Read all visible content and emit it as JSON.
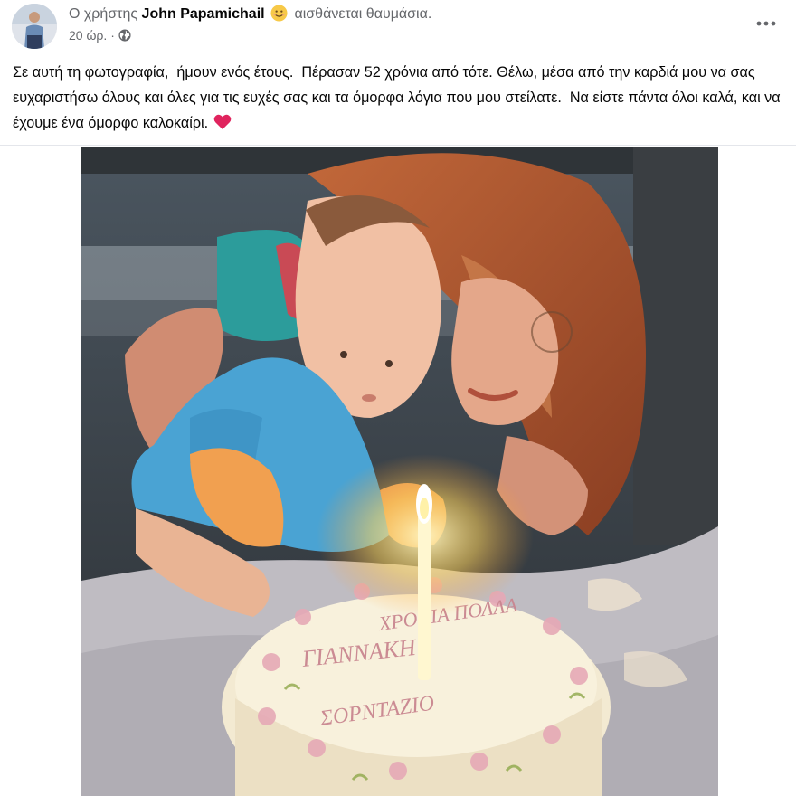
{
  "post": {
    "author_prefix": "Ο χρήστης",
    "author_name": "John Papamichail",
    "feeling_icon": "smiling-face-emoji",
    "feeling_text": "αισθάνεται θαυμάσια.",
    "time": "20 ώρ.",
    "separator": "·",
    "audience_icon": "globe-icon",
    "more_icon": "ellipsis-icon",
    "body": "Σε αυτή τη φωτογραφία,  ήμουν ενός έτους.  Πέρασαν 52 χρόνια από τότε. Θέλω, μέσα από την καρδιά μου να σας ευχαριστήσω όλους και όλες για τις ευχές σας και τα όμορφα λόγια που μου στείλατε.  Να είστε πάντα όλοι καλά, και να έχουμε ένα όμορφο καλοκαίρι.",
    "body_end_icon": "red-heart-emoji"
  },
  "photo": {
    "description_icon": "birthday-photo",
    "cake_text_line1": "ΧΡΟΝΙΑ ΠΟΛΛΑ",
    "cake_text_line2": "ΓΙΑΝΝΑΚΗ",
    "cake_text_line3": "ΣΟΡΝΤΑΖΙΟ"
  },
  "colors": {
    "text": "#050505",
    "muted": "#65676b",
    "heart": "#e0245e",
    "emoji": "#f7c948",
    "divider": "#e4e6eb"
  }
}
